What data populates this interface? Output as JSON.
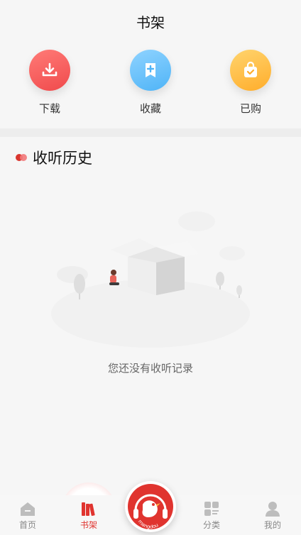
{
  "header": {
    "title": "书架"
  },
  "quick_actions": [
    {
      "label": "下载",
      "icon": "download-icon",
      "color": "#f04a4c"
    },
    {
      "label": "收藏",
      "icon": "bookmark-plus-icon",
      "color": "#4fb4f7"
    },
    {
      "label": "已购",
      "icon": "shopping-bag-check-icon",
      "color": "#ffad2b"
    }
  ],
  "history": {
    "title": "收听历史",
    "empty_text": "您还没有收听记录"
  },
  "tabbar": {
    "items": [
      {
        "label": "首页",
        "icon": "home-icon"
      },
      {
        "label": "书架",
        "icon": "bookshelf-icon",
        "active": true
      },
      {
        "label": "分类",
        "icon": "category-grid-icon"
      },
      {
        "label": "我的",
        "icon": "user-icon"
      }
    ],
    "player_logo_text": "mangdou"
  },
  "colors": {
    "accent": "#e0342f",
    "inactive": "#888888"
  }
}
